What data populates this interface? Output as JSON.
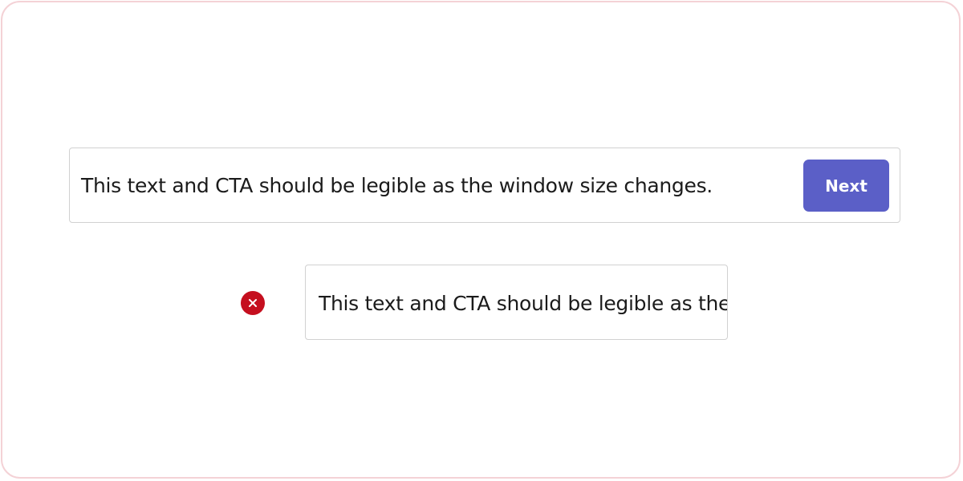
{
  "good_example": {
    "message": "This text and CTA should be legible as the window size changes.",
    "button_label": "Next",
    "button_color": "#5b5fc7"
  },
  "bad_example": {
    "message": "This text and CTA should be legible as the window size changes.",
    "status_icon": "error-icon",
    "status_color": "#c50f1f"
  },
  "colors": {
    "frame_border": "#f4d2d6",
    "card_border": "#d1d1d1",
    "text": "#1b1b1b"
  }
}
